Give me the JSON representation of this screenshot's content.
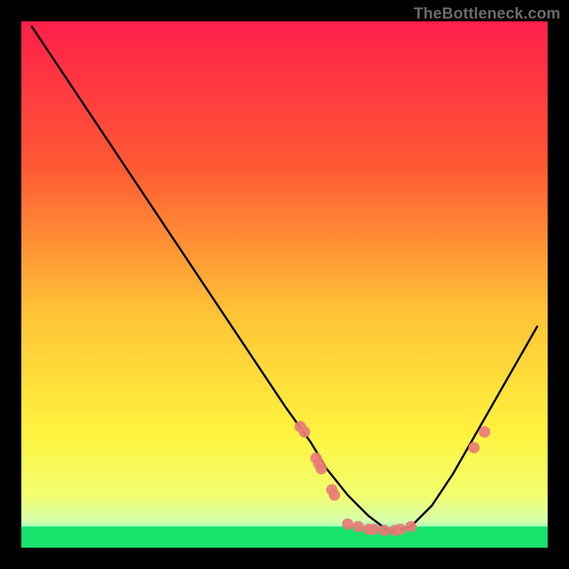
{
  "watermark": "TheBottleneck.com",
  "chart_data": {
    "type": "line",
    "title": "",
    "xlabel": "",
    "ylabel": "",
    "xlim": [
      0,
      100
    ],
    "ylim": [
      0,
      100
    ],
    "gradient_colors": {
      "top": "#ff1f4b",
      "upper_mid": "#ff7a2d",
      "mid": "#ffe23a",
      "lower_mid": "#f6ff4a",
      "bottom_band": "#e9ffb0",
      "green": "#17e36b"
    },
    "curve": {
      "description": "V-shaped bottleneck curve; minimum near x≈70, y≈3",
      "x": [
        2,
        10,
        20,
        30,
        40,
        50,
        55,
        58,
        62,
        66,
        70,
        74,
        78,
        82,
        86,
        90,
        94,
        98
      ],
      "y": [
        99,
        87,
        72,
        57,
        42,
        27,
        20,
        15,
        10,
        6,
        3,
        4,
        8,
        14,
        21,
        28,
        35,
        42
      ]
    },
    "green_band": {
      "y_start": 0,
      "y_end": 4
    },
    "markers": [
      {
        "x": 53,
        "y": 23
      },
      {
        "x": 53.8,
        "y": 22
      },
      {
        "x": 56,
        "y": 17
      },
      {
        "x": 56.5,
        "y": 16
      },
      {
        "x": 57,
        "y": 15
      },
      {
        "x": 59,
        "y": 11
      },
      {
        "x": 59.5,
        "y": 10
      },
      {
        "x": 62,
        "y": 4.5
      },
      {
        "x": 64,
        "y": 4
      },
      {
        "x": 66,
        "y": 3.5
      },
      {
        "x": 67,
        "y": 3.5
      },
      {
        "x": 69,
        "y": 3.3
      },
      {
        "x": 71,
        "y": 3.3
      },
      {
        "x": 72,
        "y": 3.5
      },
      {
        "x": 74,
        "y": 4
      },
      {
        "x": 86,
        "y": 19
      },
      {
        "x": 88,
        "y": 22
      }
    ]
  }
}
